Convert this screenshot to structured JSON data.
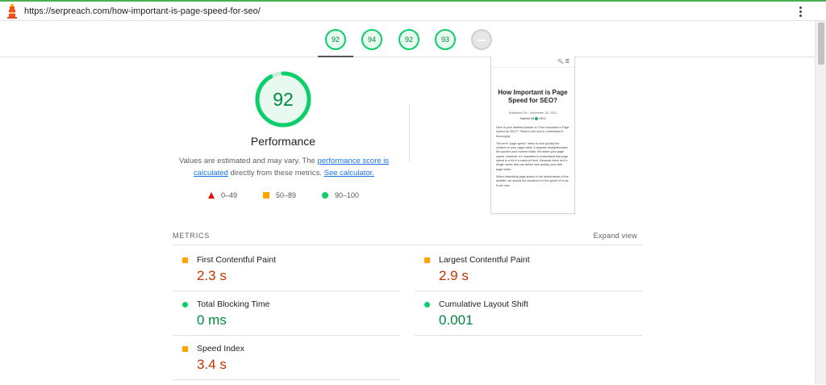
{
  "browser": {
    "url": "https://serpreach.com/how-important-is-page-speed-for-seo/"
  },
  "gauges": [
    {
      "score": "92",
      "category": "performance"
    },
    {
      "score": "94",
      "category": "accessibility"
    },
    {
      "score": "92",
      "category": "best-practices"
    },
    {
      "score": "93",
      "category": "seo"
    },
    {
      "score": "",
      "category": "pwa"
    }
  ],
  "performance": {
    "score": 92,
    "score_text": "92",
    "title": "Performance",
    "desc_before": "Values are estimated and may vary. The ",
    "desc_link1": "performance score is calculated",
    "desc_middle": " directly from these metrics. ",
    "desc_link2": "See calculator.",
    "legend": {
      "poor": "0–49",
      "average": "50–89",
      "good": "90–100"
    }
  },
  "screenshot": {
    "title": "How Important is Page Speed for SEO?",
    "published": "Published On - November 26, 2022",
    "author": "Saleine Ali",
    "author_tag": "SEO",
    "paragraphs": [
      "Here is your detailed answer to \"How Important is Page Speed for SEO?\". Read to the end to understand it thoroughly.",
      "The term \"page speed\" refers to how quickly the content on your page loads. It appears straightforward; the quicker your content loads, the faster your page speed. However, it's important to understand that page speed is a bit of a catch-all term. Because there isn't a single metric that can define how quickly your web page loads.",
      "When describing page speed in the performance of the website, we should not construe it in the speed of a car. It can now"
    ]
  },
  "metrics": {
    "label": "METRICS",
    "expand": "Expand view",
    "items": [
      {
        "name": "First Contentful Paint",
        "value": "2.3 s",
        "status": "average"
      },
      {
        "name": "Largest Contentful Paint",
        "value": "2.9 s",
        "status": "average"
      },
      {
        "name": "Total Blocking Time",
        "value": "0 ms",
        "status": "good"
      },
      {
        "name": "Cumulative Layout Shift",
        "value": "0.001",
        "status": "good"
      },
      {
        "name": "Speed Index",
        "value": "3.4 s",
        "status": "average"
      }
    ]
  },
  "colors": {
    "good": "#0cce6b",
    "average": "#ffa400",
    "poor": "#eb0f00",
    "good_text": "#018642",
    "average_text": "#c33300",
    "link": "#1a73e8"
  }
}
